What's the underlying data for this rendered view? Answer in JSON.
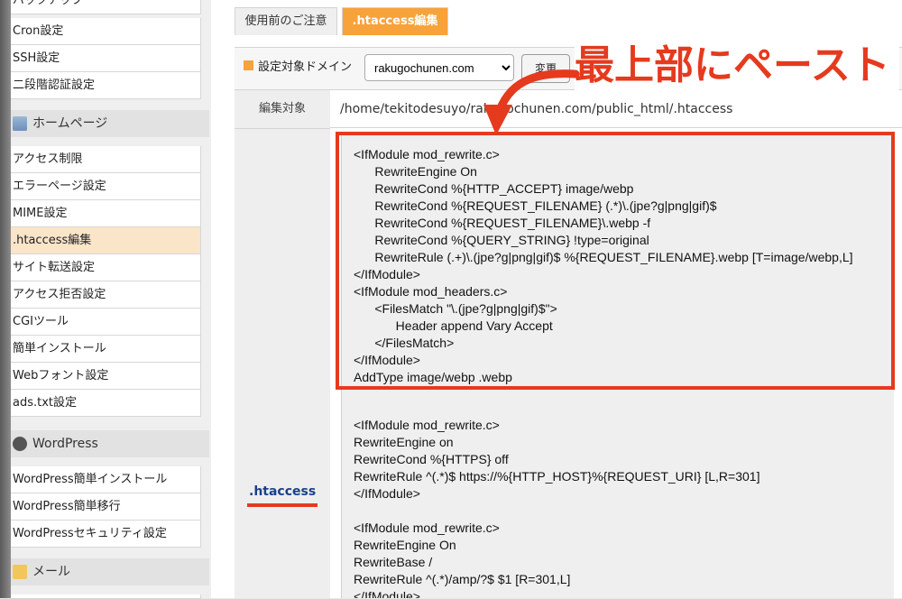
{
  "sidebar": {
    "top_items": [
      "バックアップ",
      "Cron設定",
      "SSH設定",
      "二段階認証設定"
    ],
    "homepage_section": "ホームページ",
    "homepage_items": [
      "アクセス制限",
      "エラーページ設定",
      "MIME設定",
      ".htaccess編集",
      "サイト転送設定",
      "アクセス拒否設定",
      "CGIツール",
      "簡単インストール",
      "Webフォント設定",
      "ads.txt設定"
    ],
    "wordpress_section": "WordPress",
    "wordpress_items": [
      "WordPress簡単インストール",
      "WordPress簡単移行",
      "WordPressセキュリティ設定"
    ],
    "mail_section": "メール"
  },
  "tabs": {
    "notice": "使用前のご注意",
    "edit": ".htaccess編集"
  },
  "form": {
    "domain_label": "設定対象ドメイン",
    "domain_value": "rakugochunen.com",
    "change_button": "変更",
    "target_label": "編集対象",
    "target_path": "/home/tekitodesuyo/rakugochunen.com/public_html/.htaccess",
    "htaccess_label": ".htaccess"
  },
  "annotation": "最上部にペースト",
  "code_block_highlighted": [
    "<IfModule mod_rewrite.c>",
    "      RewriteEngine On",
    "      RewriteCond %{HTTP_ACCEPT} image/webp",
    "      RewriteCond %{REQUEST_FILENAME} (.*)\\.(jpe?g|png|gif)$",
    "      RewriteCond %{REQUEST_FILENAME}\\.webp -f",
    "      RewriteCond %{QUERY_STRING} !type=original",
    "      RewriteRule (.+)\\.(jpe?g|png|gif)$ %{REQUEST_FILENAME}.webp [T=image/webp,L]",
    "</IfModule>",
    "<IfModule mod_headers.c>",
    "      <FilesMatch \"\\.(jpe?g|png|gif)$\">",
    "            Header append Vary Accept",
    "      </FilesMatch>",
    "</IfModule>",
    "AddType image/webp .webp"
  ],
  "code_block_existing": [
    "<IfModule mod_rewrite.c>",
    "RewriteEngine on",
    "RewriteCond %{HTTPS} off",
    "RewriteRule ^(.*)$ https://%{HTTP_HOST}%{REQUEST_URI} [L,R=301]",
    "</IfModule>",
    "",
    "<IfModule mod_rewrite.c>",
    "RewriteEngine On",
    "RewriteBase /",
    "RewriteRule ^(.*)/amp/?$ $1 [R=301,L]",
    "</IfModule>"
  ],
  "colors": {
    "accent": "#f7a23a",
    "highlight": "#e53a1e",
    "active_menu": "#fbe5c9"
  }
}
